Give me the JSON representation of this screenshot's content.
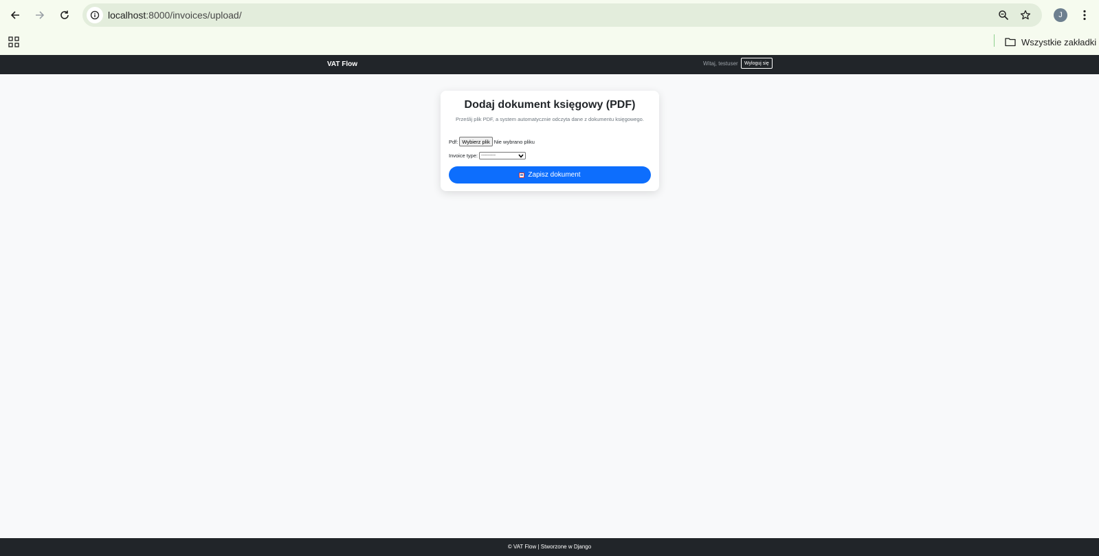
{
  "browser": {
    "url_host": "localhost",
    "url_rest": ":8000/invoices/upload/",
    "avatar_letter": "J",
    "bookmarks_folder": "Wszystkie zakładki"
  },
  "navbar": {
    "brand": "VAT Flow",
    "welcome": "Witaj, testuser",
    "logout": "Wyloguj się"
  },
  "form": {
    "title": "Dodaj dokument księgowy (PDF)",
    "subtitle": "Prześlij plik PDF, a system automatycznie odczyta dane z dokumentu księgowego.",
    "pdf_label": "Pdf:",
    "file_button": "Wybierz plik",
    "file_status": "Nie wybrano pliku",
    "invoice_type_label": "Invoice type:",
    "invoice_type_value": "---------",
    "save_button": "Zapisz dokument"
  },
  "footer": {
    "text": "© VAT Flow | Stworzone w Django"
  },
  "colors": {
    "navbar_bg": "#212529",
    "primary_button": "#0d6efd",
    "page_bg": "#f8f9fa"
  },
  "icons": [
    "back-icon",
    "forward-icon",
    "reload-icon",
    "info-icon",
    "zoom-icon",
    "star-icon",
    "menu-icon",
    "apps-icon",
    "folder-icon",
    "save-icon"
  ]
}
